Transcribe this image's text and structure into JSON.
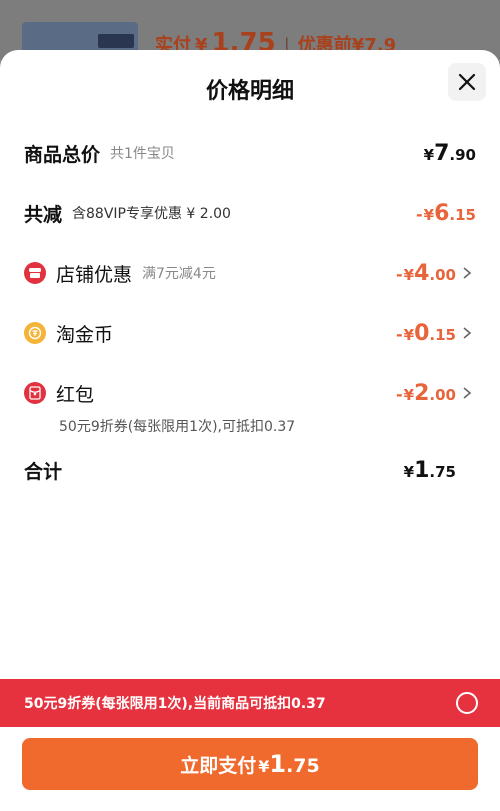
{
  "background": {
    "paid_prefix": "实付",
    "paid_yen": "¥",
    "paid_amount": "1.75",
    "before_discount": "优惠前¥7.9"
  },
  "sheet": {
    "title": "价格明细"
  },
  "rows": {
    "total": {
      "label": "商品总价",
      "sub": "共1件宝贝",
      "yen": "¥",
      "int": "7",
      "dec": ".90"
    },
    "reduce": {
      "label": "共减",
      "sub": "含88VIP专享优惠 ¥ 2.00",
      "minus": "-",
      "yen": "¥",
      "int": "6",
      "dec": ".15"
    },
    "store": {
      "label": "店铺优惠",
      "sub": "满7元减4元",
      "minus": "-",
      "yen": "¥",
      "int": "4",
      "dec": ".00",
      "icon": "store-icon"
    },
    "coin": {
      "label": "淘金币",
      "minus": "-",
      "yen": "¥",
      "int": "0",
      "dec": ".15",
      "icon": "coin-icon"
    },
    "hongbao": {
      "label": "红包",
      "note": "50元9折券(每张限用1次),可抵扣0.37",
      "minus": "-",
      "yen": "¥",
      "int": "2",
      "dec": ".00",
      "icon": "red-packet-icon"
    },
    "sum": {
      "label": "合计",
      "yen": "¥",
      "int": "1",
      "dec": ".75"
    }
  },
  "banner": {
    "text": "50元9折券(每张限用1次),当前商品可抵扣0.37",
    "selected": false
  },
  "pay_button": {
    "label": "立即支付",
    "yen": "¥",
    "int": "1",
    "dec": ".75"
  },
  "colors": {
    "accent_orange": "#ef6a2c",
    "discount": "#e8643a",
    "banner_red": "#e6323f"
  }
}
